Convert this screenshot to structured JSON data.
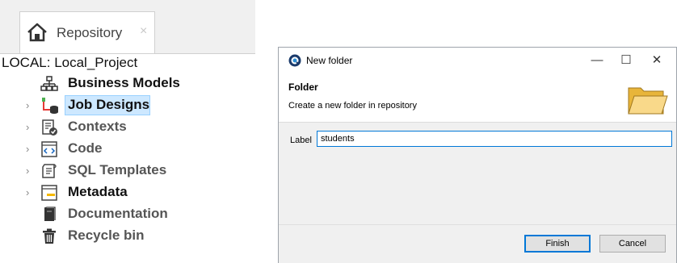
{
  "repository": {
    "tab_label": "Repository",
    "tab_close": "×",
    "project_label": "LOCAL: Local_Project",
    "items": [
      {
        "label": "Business Models",
        "icon": "hierarchy-icon",
        "expandable": false,
        "style": "dark"
      },
      {
        "label": "Job Designs",
        "icon": "job-designs-icon",
        "expandable": true,
        "style": "dark",
        "selected": true
      },
      {
        "label": "Contexts",
        "icon": "contexts-icon",
        "expandable": true,
        "style": "gray"
      },
      {
        "label": "Code",
        "icon": "code-icon",
        "expandable": true,
        "style": "gray"
      },
      {
        "label": "SQL Templates",
        "icon": "sql-templates-icon",
        "expandable": true,
        "style": "gray"
      },
      {
        "label": "Metadata",
        "icon": "metadata-icon",
        "expandable": true,
        "style": "dark"
      },
      {
        "label": "Documentation",
        "icon": "book-icon",
        "expandable": false,
        "style": "gray"
      },
      {
        "label": "Recycle bin",
        "icon": "trash-icon",
        "expandable": false,
        "style": "gray"
      }
    ],
    "expand_arrow": "›"
  },
  "dialog": {
    "title": "New folder",
    "controls": {
      "minimize": "—",
      "maximize": "☐",
      "close": "✕"
    },
    "header_title": "Folder",
    "header_description": "Create a new folder in repository",
    "label_text": "Label",
    "label_value": "students",
    "finish_label": "Finish",
    "cancel_label": "Cancel"
  },
  "colors": {
    "selection": "#cde8ff",
    "accent": "#0078d7"
  }
}
